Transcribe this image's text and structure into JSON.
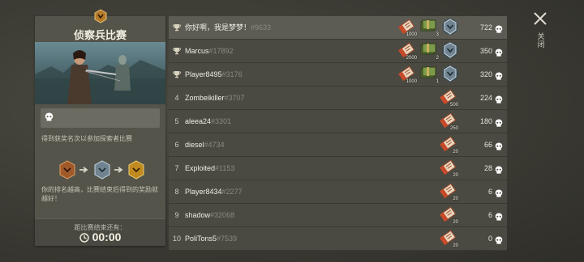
{
  "event": {
    "title": "侦察兵比赛",
    "info_text": "得到获奖名次以参加探索者比赛",
    "tier_note": "你的排名越高，比赛结束后得到的奖励就越好！",
    "timer_label": "距比赛结束还有：",
    "timer_value": "00:00"
  },
  "close": {
    "label": "关闭"
  },
  "leaderboard": [
    {
      "rank": "",
      "name": "你好啊，我是梦梦！",
      "tag": "#9633",
      "score": "722",
      "trophy": true,
      "me": true,
      "rewards": [
        {
          "type": "ticket",
          "count": "1000"
        },
        {
          "type": "cash",
          "count": "3"
        },
        {
          "type": "badge-silver",
          "count": ""
        }
      ]
    },
    {
      "rank": "",
      "name": "Marcus",
      "tag": "#17892",
      "score": "350",
      "trophy": true,
      "rewards": [
        {
          "type": "ticket",
          "count": "2000"
        },
        {
          "type": "cash",
          "count": "2"
        },
        {
          "type": "badge-silver",
          "count": ""
        }
      ]
    },
    {
      "rank": "",
      "name": "Player8495",
      "tag": "#3176",
      "score": "320",
      "trophy": true,
      "rewards": [
        {
          "type": "ticket",
          "count": "1000"
        },
        {
          "type": "cash",
          "count": "1"
        },
        {
          "type": "badge-silver",
          "count": ""
        }
      ]
    },
    {
      "rank": "4",
      "name": "Zombeikiller",
      "tag": "#3707",
      "score": "224",
      "rewards": [
        {
          "type": "ticket",
          "count": "500"
        }
      ]
    },
    {
      "rank": "5",
      "name": "aleea24",
      "tag": "#3301",
      "score": "180",
      "rewards": [
        {
          "type": "ticket",
          "count": "250"
        }
      ]
    },
    {
      "rank": "6",
      "name": "diesel",
      "tag": "#4734",
      "score": "66",
      "rewards": [
        {
          "type": "ticket",
          "count": "20"
        }
      ]
    },
    {
      "rank": "7",
      "name": "Exploited",
      "tag": "#1153",
      "score": "28",
      "rewards": [
        {
          "type": "ticket",
          "count": "20"
        }
      ]
    },
    {
      "rank": "8",
      "name": "Player8434",
      "tag": "#2277",
      "score": "6",
      "rewards": [
        {
          "type": "ticket",
          "count": "20"
        }
      ]
    },
    {
      "rank": "9",
      "name": "shadow",
      "tag": "#32068",
      "score": "6",
      "rewards": [
        {
          "type": "ticket",
          "count": "20"
        }
      ]
    },
    {
      "rank": "10",
      "name": "PoliTons5",
      "tag": "#7539",
      "score": "0",
      "rewards": [
        {
          "type": "ticket",
          "count": "20"
        }
      ]
    }
  ]
}
